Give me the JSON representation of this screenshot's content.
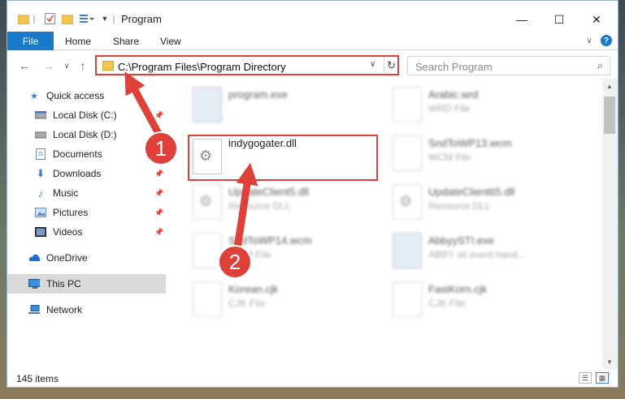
{
  "window": {
    "title": "Program",
    "quick_access_icons": [
      "folder-icon",
      "properties-icon",
      "new-folder-icon",
      "customize-icon"
    ]
  },
  "ribbon": {
    "file_label": "File",
    "tabs": [
      "Home",
      "Share",
      "View"
    ],
    "help_label": "?"
  },
  "navigation": {
    "address": "C:\\Program Files\\Program Directory",
    "search_placeholder": "Search Program"
  },
  "sidebar": {
    "items": [
      {
        "label": "Quick access",
        "icon": "star-icon",
        "pinned": false
      },
      {
        "label": "Local Disk (C:)",
        "icon": "drive-icon",
        "pinned": true
      },
      {
        "label": "Local Disk (D:)",
        "icon": "drive-icon",
        "pinned": true
      },
      {
        "label": "Documents",
        "icon": "documents-icon",
        "pinned": true
      },
      {
        "label": "Downloads",
        "icon": "download-icon",
        "pinned": true
      },
      {
        "label": "Music",
        "icon": "music-icon",
        "pinned": true
      },
      {
        "label": "Pictures",
        "icon": "pictures-icon",
        "pinned": true
      },
      {
        "label": "Videos",
        "icon": "videos-icon",
        "pinned": true
      },
      {
        "label": "OneDrive",
        "icon": "cloud-icon",
        "pinned": false
      },
      {
        "label": "This PC",
        "icon": "computer-icon",
        "pinned": false,
        "selected": true
      },
      {
        "label": "Network",
        "icon": "network-icon",
        "pinned": false
      }
    ]
  },
  "files": [
    {
      "name": "program.exe",
      "type": "",
      "icon": "exe"
    },
    {
      "name": "Arabic.wrd",
      "type": "WRD File",
      "icon": "file"
    },
    {
      "name": "indygogater.dll",
      "type": "",
      "icon": "dll",
      "highlighted": true
    },
    {
      "name": "SndToWP13.wcm",
      "type": "WCM File",
      "icon": "file"
    },
    {
      "name": "UpdateClient5.dll",
      "type": "Resource DLL",
      "icon": "dll"
    },
    {
      "name": "UpdateClient65.dll",
      "type": "Resource DLL",
      "icon": "dll"
    },
    {
      "name": "SndToWP14.wcm",
      "type": "WCM File",
      "icon": "file"
    },
    {
      "name": "AbbyySTI.exe",
      "type": "ABBY sti event hand...",
      "icon": "exe"
    },
    {
      "name": "Korean.cjk",
      "type": "CJK File",
      "icon": "file"
    },
    {
      "name": "FastKorn.cjk",
      "type": "CJK File",
      "icon": "file"
    }
  ],
  "status": {
    "item_count": "145 items"
  },
  "annotations": {
    "step1": "1",
    "step2": "2",
    "color": "#e0403a"
  }
}
